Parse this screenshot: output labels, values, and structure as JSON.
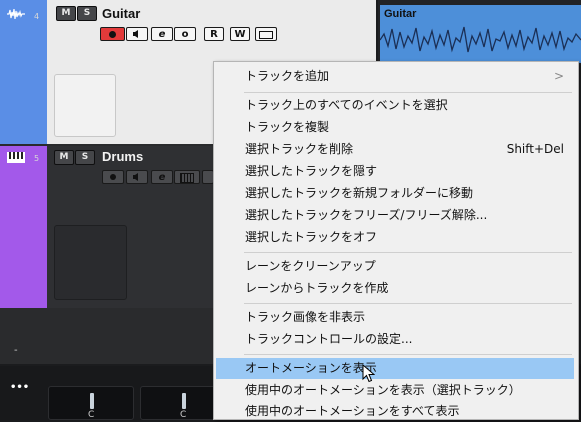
{
  "tracks": [
    {
      "number": "4",
      "name": "Guitar",
      "mute": "M",
      "solo": "S",
      "read": "R",
      "write": "W",
      "color": "#5a8ee6"
    },
    {
      "number": "5",
      "name": "Drums",
      "mute": "M",
      "solo": "S",
      "color": "#a359ea"
    }
  ],
  "event": {
    "name": "Guitar",
    "color": "#4d8fd9"
  },
  "tracklist_footer": "-",
  "mixer": {
    "menu_icon": "•••",
    "channels": [
      {
        "label": "C"
      },
      {
        "label": "C"
      }
    ]
  },
  "context_menu": {
    "items": [
      {
        "label": "トラックを追加",
        "submenu": ">"
      },
      {
        "label": "トラック上のすべてのイベントを選択"
      },
      {
        "label": "トラックを複製"
      },
      {
        "label": "選択トラックを削除",
        "shortcut": "Shift+Del"
      },
      {
        "label": "選択したトラックを隠す"
      },
      {
        "label": "選択したトラックを新規フォルダーに移動"
      },
      {
        "label": "選択したトラックをフリーズ/フリーズ解除..."
      },
      {
        "label": "選択したトラックをオフ"
      },
      {
        "label": "レーンをクリーンアップ"
      },
      {
        "label": "レーンからトラックを作成"
      },
      {
        "label": "トラック画像を非表示"
      },
      {
        "label": "トラックコントロールの設定..."
      },
      {
        "label": "オートメーションを表示"
      },
      {
        "label": "使用中のオートメーションを表示（選択トラック）"
      },
      {
        "label": "使用中のオートメーションをすべて表示"
      }
    ],
    "highlighted_index": 12
  }
}
